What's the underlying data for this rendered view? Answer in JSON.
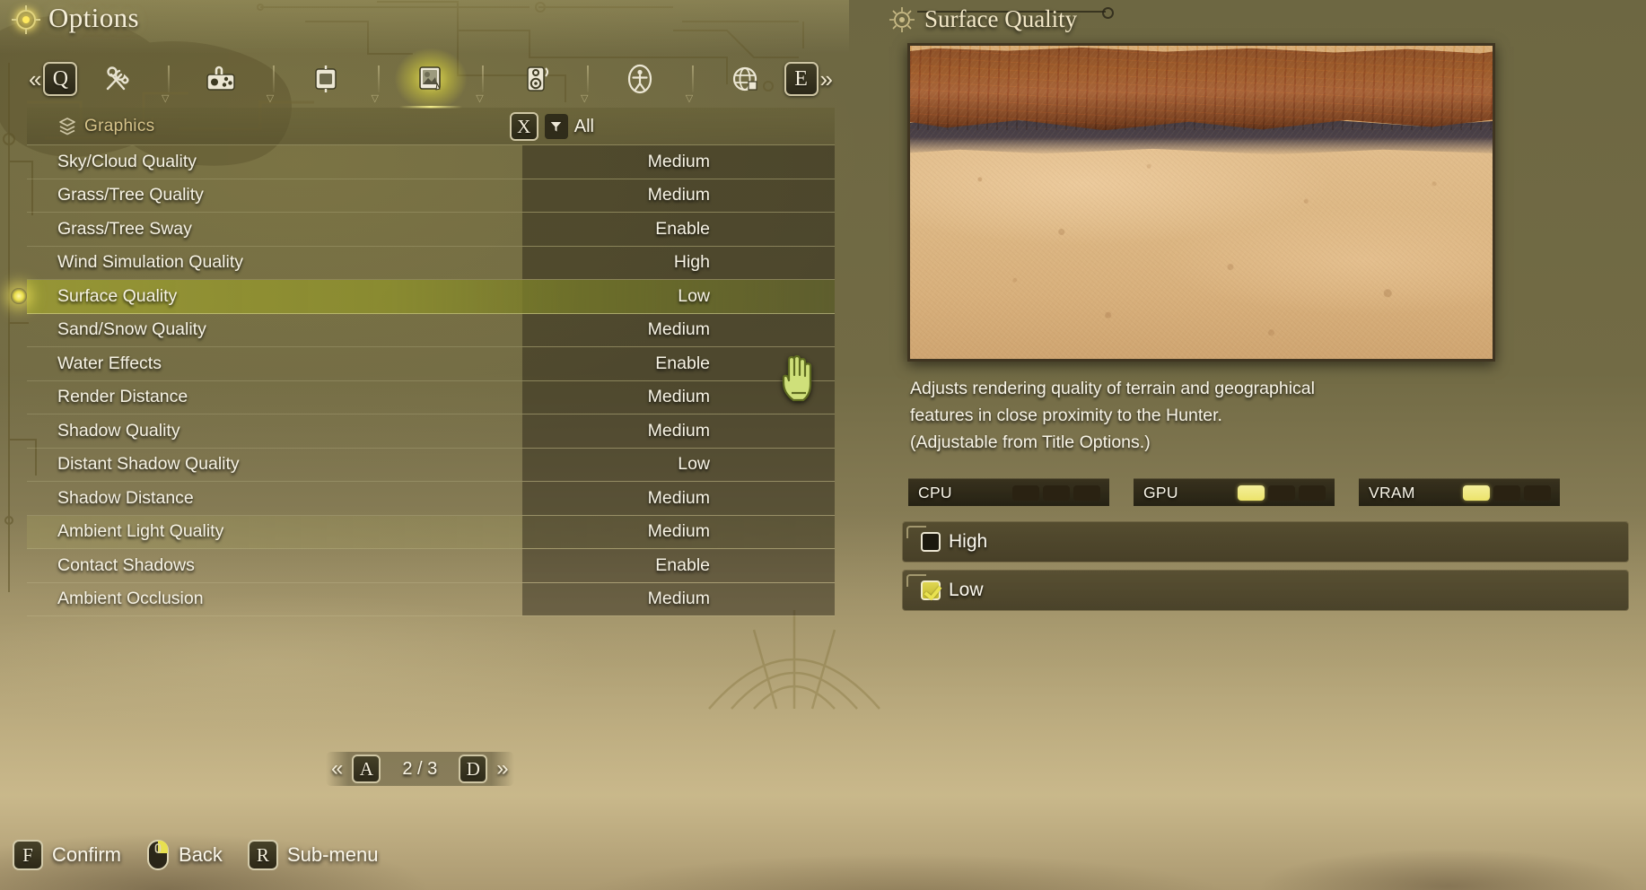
{
  "window": {
    "title": "Options"
  },
  "tabs": {
    "prev_key": "Q",
    "next_key": "E",
    "prev_arrow": "«",
    "next_arrow": "»",
    "items": [
      {
        "icon": "tools-icon",
        "name": "tab-general",
        "selected": false
      },
      {
        "icon": "gamepad-icon",
        "name": "tab-controls",
        "selected": false
      },
      {
        "icon": "display-icon",
        "name": "tab-display",
        "selected": false
      },
      {
        "icon": "image-icon",
        "name": "tab-graphics",
        "selected": true
      },
      {
        "icon": "speaker-icon",
        "name": "tab-audio",
        "selected": false
      },
      {
        "icon": "accessibility-icon",
        "name": "tab-accessibility",
        "selected": false
      },
      {
        "icon": "globe-icon",
        "name": "tab-language",
        "selected": false
      }
    ]
  },
  "list_header": {
    "category": "Graphics",
    "close_key": "X",
    "filter_label": "All"
  },
  "settings": [
    {
      "name": "Sky/Cloud Quality",
      "value": "Medium",
      "state": "normal"
    },
    {
      "name": "Grass/Tree Quality",
      "value": "Medium",
      "state": "normal"
    },
    {
      "name": "Grass/Tree Sway",
      "value": "Enable",
      "state": "normal"
    },
    {
      "name": "Wind Simulation Quality",
      "value": "High",
      "state": "normal"
    },
    {
      "name": "Surface Quality",
      "value": "Low",
      "state": "selected"
    },
    {
      "name": "Sand/Snow Quality",
      "value": "Medium",
      "state": "normal"
    },
    {
      "name": "Water Effects",
      "value": "Enable",
      "state": "normal"
    },
    {
      "name": "Render Distance",
      "value": "Medium",
      "state": "normal"
    },
    {
      "name": "Shadow Quality",
      "value": "Medium",
      "state": "normal"
    },
    {
      "name": "Distant Shadow Quality",
      "value": "Low",
      "state": "normal"
    },
    {
      "name": "Shadow Distance",
      "value": "Medium",
      "state": "normal"
    },
    {
      "name": "Ambient Light Quality",
      "value": "Medium",
      "state": "soft-hi"
    },
    {
      "name": "Contact Shadows",
      "value": "Enable",
      "state": "normal"
    },
    {
      "name": "Ambient Occlusion",
      "value": "Medium",
      "state": "normal"
    }
  ],
  "pager": {
    "prev_arrow": "«",
    "prev_key": "A",
    "indicator": "2 / 3",
    "next_key": "D",
    "next_arrow": "»"
  },
  "detail": {
    "title": "Surface Quality",
    "description_lines": [
      "Adjusts rendering quality of terrain and geographical",
      "features in close proximity to the Hunter.",
      "(Adjustable from Title Options.)"
    ],
    "performance": [
      {
        "label": "CPU",
        "segments": [
          false,
          false,
          false
        ]
      },
      {
        "label": "GPU",
        "segments": [
          true,
          false,
          false
        ]
      },
      {
        "label": "VRAM",
        "segments": [
          true,
          false,
          false
        ]
      }
    ],
    "choices": [
      {
        "label": "High",
        "checked": false
      },
      {
        "label": "Low",
        "checked": true
      }
    ]
  },
  "footer": {
    "items": [
      {
        "key": "F",
        "label": "Confirm",
        "icon": "key-f"
      },
      {
        "key": "",
        "label": "Back",
        "icon": "mouse-right-click-icon"
      },
      {
        "key": "R",
        "label": "Sub-menu",
        "icon": "key-r"
      }
    ]
  },
  "colors": {
    "accent_yellow": "#ece36a",
    "selection_olive": "#989834",
    "title_cream": "#f3e8c8",
    "category_gold": "#d6c38a"
  }
}
